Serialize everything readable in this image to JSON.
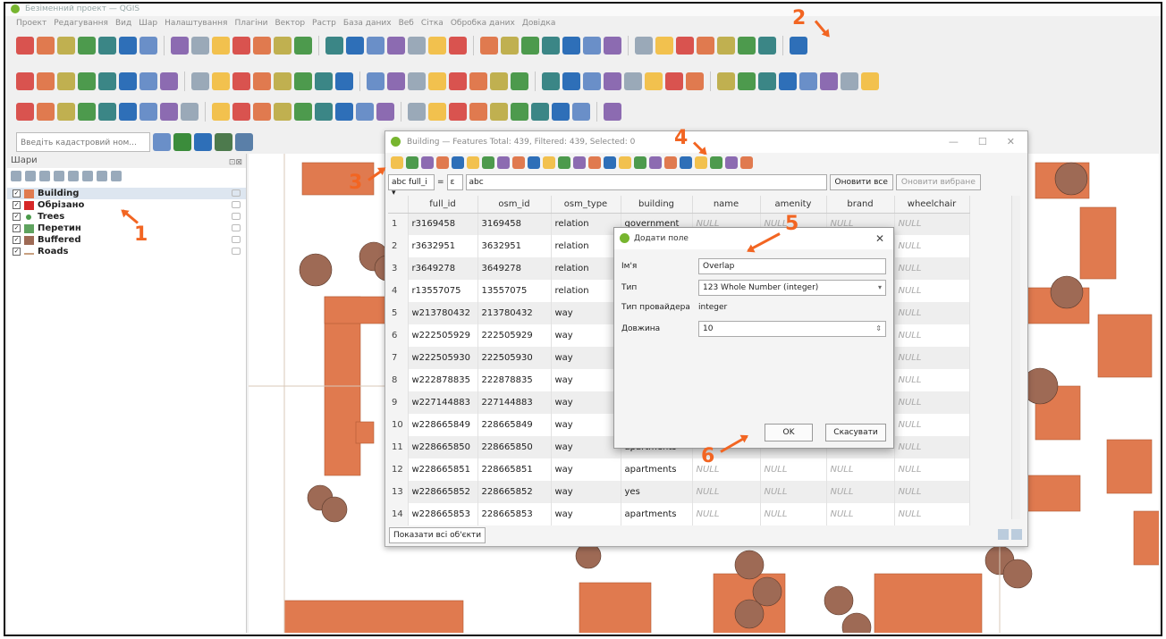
{
  "window": {
    "title": "Безіменний проект — QGIS"
  },
  "menu": [
    "Проект",
    "Редагування",
    "Вид",
    "Шар",
    "Налаштування",
    "Плагіни",
    "Вектор",
    "Растр",
    "База даних",
    "Веб",
    "Сітка",
    "Обробка даних",
    "Довідка"
  ],
  "toolbar": {
    "locator_placeholder": "Введіть кадастровий ном...",
    "font_size": "12",
    "font_unit": "pt"
  },
  "layers_panel": {
    "title": "Шари",
    "layers": [
      {
        "name": "Building",
        "color": "#e07a4f",
        "kind": "polygon",
        "selected": true
      },
      {
        "name": "Обрізано",
        "color": "#d62727",
        "kind": "polygon"
      },
      {
        "name": "Trees",
        "color": "#4a9a4a",
        "kind": "point"
      },
      {
        "name": "Перетин",
        "color": "#5fa35f",
        "kind": "polygon"
      },
      {
        "name": "Buffered",
        "color": "#9e6a55",
        "kind": "polygon"
      },
      {
        "name": "Roads",
        "color": "#c8a080",
        "kind": "line"
      }
    ]
  },
  "attribute_table": {
    "title": "Building — Features Total: 439, Filtered: 439, Selected: 0",
    "field_selector": "full_i",
    "expression_value": "abc",
    "update_all": "Оновити все",
    "update_selected": "Оновити вибране",
    "columns": [
      "full_id",
      "osm_id",
      "osm_type",
      "building",
      "name",
      "amenity",
      "brand",
      "wheelchair"
    ],
    "rows": [
      [
        "1",
        "r3169458",
        "3169458",
        "relation",
        "government",
        "NULL",
        "NULL",
        "NULL",
        "NULL"
      ],
      [
        "2",
        "r3632951",
        "3632951",
        "relation",
        "",
        "",
        "",
        "",
        "NULL"
      ],
      [
        "3",
        "r3649278",
        "3649278",
        "relation",
        "",
        "",
        "",
        "",
        "NULL"
      ],
      [
        "4",
        "r13557075",
        "13557075",
        "relation",
        "",
        "",
        "",
        "",
        "NULL"
      ],
      [
        "5",
        "w213780432",
        "213780432",
        "way",
        "",
        "",
        "",
        "",
        "NULL"
      ],
      [
        "6",
        "w222505929",
        "222505929",
        "way",
        "",
        "",
        "",
        "",
        "NULL"
      ],
      [
        "7",
        "w222505930",
        "222505930",
        "way",
        "",
        "",
        "",
        "",
        "NULL"
      ],
      [
        "8",
        "w222878835",
        "222878835",
        "way",
        "",
        "",
        "",
        "",
        "NULL"
      ],
      [
        "9",
        "w227144883",
        "227144883",
        "way",
        "",
        "",
        "",
        "",
        "NULL"
      ],
      [
        "10",
        "w228665849",
        "228665849",
        "way",
        "",
        "",
        "",
        "",
        "NULL"
      ],
      [
        "11",
        "w228665850",
        "228665850",
        "way",
        "apartments",
        "",
        "",
        "",
        "NULL"
      ],
      [
        "12",
        "w228665851",
        "228665851",
        "way",
        "apartments",
        "NULL",
        "NULL",
        "NULL",
        "NULL"
      ],
      [
        "13",
        "w228665852",
        "228665852",
        "way",
        "yes",
        "NULL",
        "NULL",
        "NULL",
        "NULL"
      ],
      [
        "14",
        "w228665853",
        "228665853",
        "way",
        "apartments",
        "NULL",
        "NULL",
        "NULL",
        "NULL"
      ]
    ],
    "show_all": "Показати всі об'єкти"
  },
  "add_field_dialog": {
    "title": "Додати поле",
    "name_label": "Ім'я",
    "name_value": "Overlap",
    "type_label": "Тип",
    "type_value": "123 Whole Number (integer)",
    "provider_label": "Тип провайдера",
    "provider_value": "integer",
    "length_label": "Довжина",
    "length_value": "10",
    "ok": "OK",
    "cancel": "Скасувати"
  },
  "annotations": [
    "1",
    "2",
    "3",
    "4",
    "5",
    "6"
  ],
  "colors": {
    "building": "#e07a4f",
    "buffer": "#9e6a55",
    "annotation": "#f26522"
  }
}
